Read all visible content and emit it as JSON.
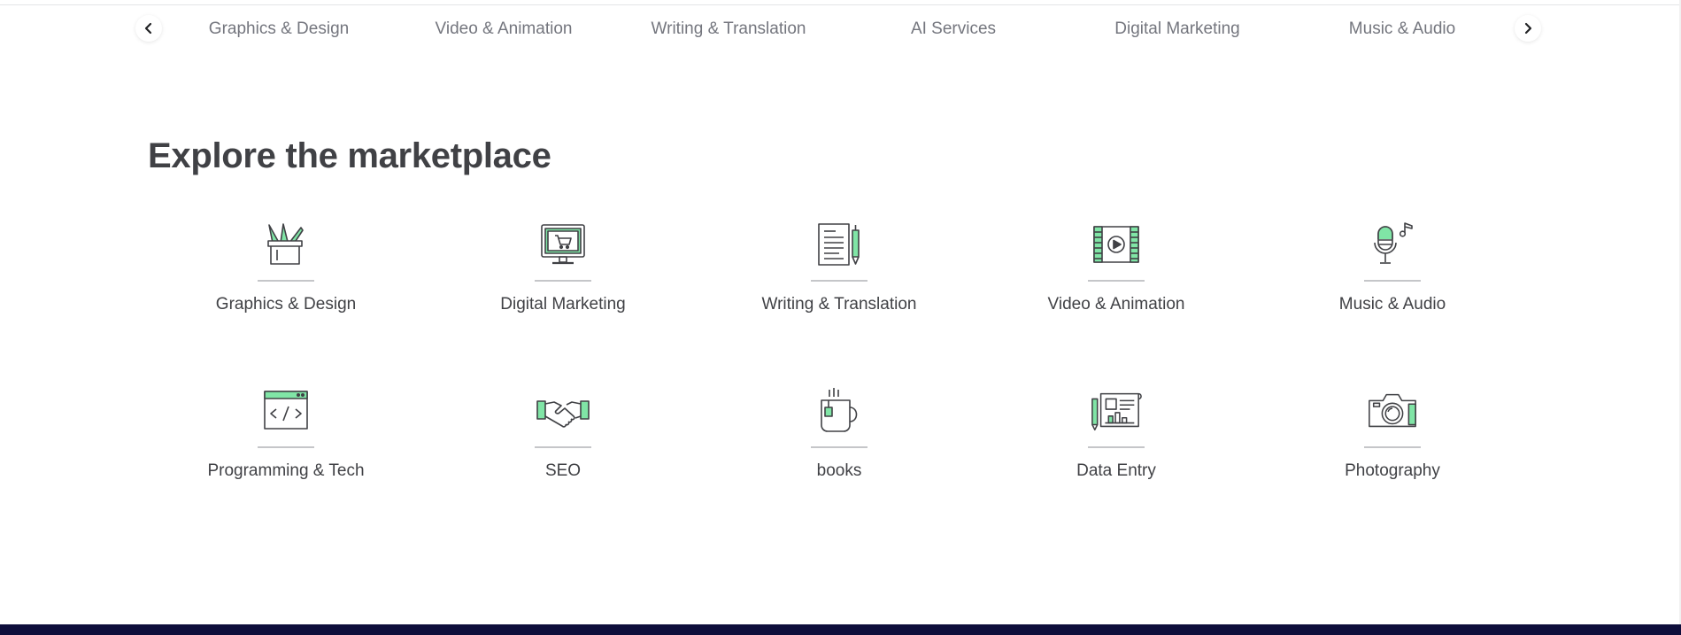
{
  "nav": {
    "categories": [
      "Graphics & Design",
      "Video & Animation",
      "Writing & Translation",
      "AI Services",
      "Digital Marketing",
      "Music & Audio"
    ]
  },
  "explore": {
    "title": "Explore the marketplace",
    "items": [
      {
        "label": "Graphics & Design",
        "icon": "pencil-cup-icon"
      },
      {
        "label": "Digital Marketing",
        "icon": "monitor-cart-icon"
      },
      {
        "label": "Writing & Translation",
        "icon": "document-pen-icon"
      },
      {
        "label": "Video & Animation",
        "icon": "film-play-icon"
      },
      {
        "label": "Music & Audio",
        "icon": "microphone-note-icon"
      },
      {
        "label": "Programming & Tech",
        "icon": "code-window-icon"
      },
      {
        "label": "SEO",
        "icon": "handshake-icon"
      },
      {
        "label": "books",
        "icon": "tea-mug-icon"
      },
      {
        "label": "Data Entry",
        "icon": "blueprint-chart-icon"
      },
      {
        "label": "Photography",
        "icon": "camera-icon"
      }
    ]
  },
  "colors": {
    "accent": "#80e5a6",
    "text": "#404145",
    "muted": "#74767e",
    "footer": "#0e0e3b"
  }
}
